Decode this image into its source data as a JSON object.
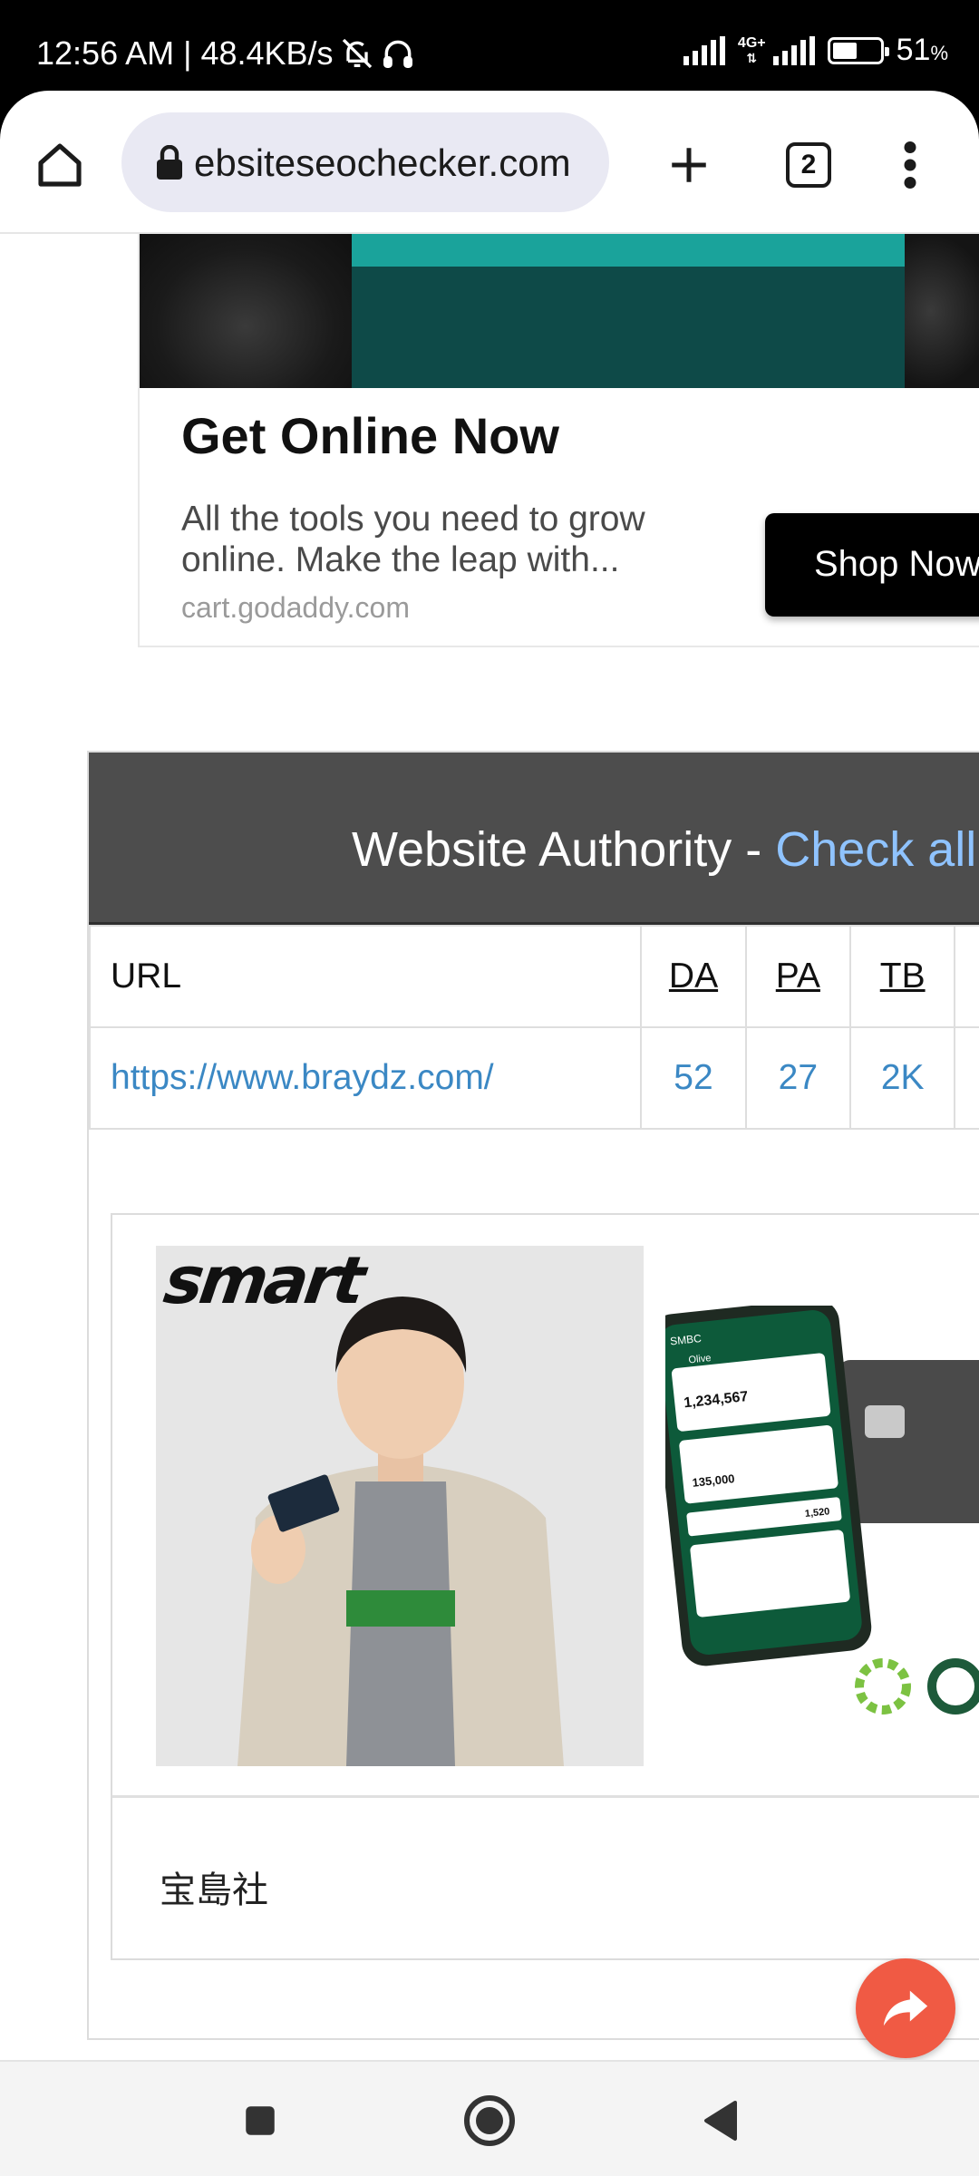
{
  "status_bar": {
    "time_speed": "12:56 AM | 48.4KB/s",
    "network": "4G+",
    "battery_level": 0.51,
    "battery_percent": "51",
    "percent_sign": "%"
  },
  "browser": {
    "url": "ebsiteseochecker.com",
    "tab_count": "2"
  },
  "ad1": {
    "headline": "Get Online Now",
    "description": "All the tools you need to grow online. Make the leap with...",
    "domain": "cart.godaddy.com",
    "cta": "Shop Now"
  },
  "authority": {
    "title": "Website Authority - ",
    "title_link": "Check all",
    "columns": [
      "URL",
      "DA",
      "PA",
      "TB"
    ],
    "rows": [
      {
        "url": "https://www.braydz.com/",
        "da": "52",
        "pa": "27",
        "tb": "2K"
      }
    ]
  },
  "ad2": {
    "brand": "smart",
    "caption": "宝島社",
    "phone_brand": "SMBC",
    "phone_app": "Olive",
    "phone_balance": "1,234,567",
    "phone_sub_amount": "135,000",
    "phone_points": "1,520"
  },
  "colors": {
    "accent_link": "#3b88c4",
    "fab": "#f05a44",
    "header_bg": "#4d4d4d"
  }
}
